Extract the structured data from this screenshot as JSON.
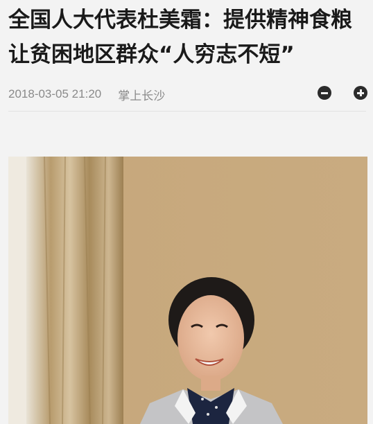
{
  "article": {
    "title": "全国人大代表杜美霜：提供精神食粮 让贫困地区群众“人穷志不短”",
    "date": "2018-03-05 21:20",
    "source": "掌上长沙"
  },
  "icons": {
    "decrease_font": "minus-circle-icon",
    "increase_font": "plus-circle-icon"
  },
  "colors": {
    "background": "#f3f3f3",
    "title": "#1a1a1a",
    "meta": "#8a8a8a"
  }
}
